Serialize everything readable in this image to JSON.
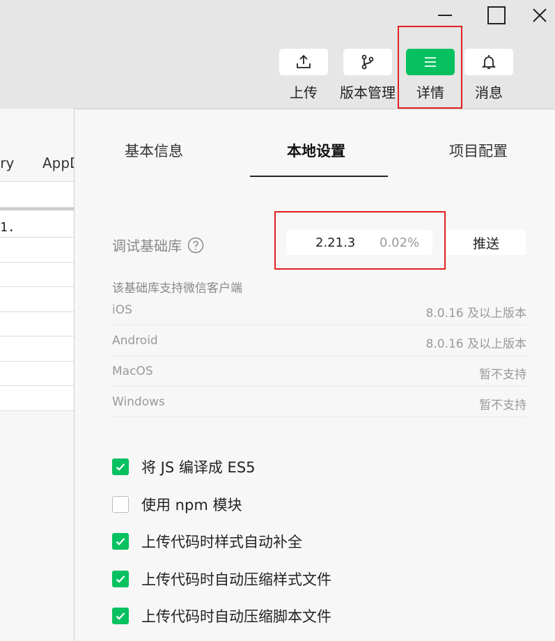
{
  "toolbar": {
    "upload_label": "上传",
    "version_label": "版本管理",
    "detail_label": "详情",
    "message_label": "消息"
  },
  "left_pane": {
    "tab1": "ory",
    "tab2": "AppD",
    "code_fragment": "1."
  },
  "panel": {
    "tabs": [
      {
        "label": "基本信息"
      },
      {
        "label": "本地设置"
      },
      {
        "label": "项目配置"
      }
    ],
    "active_tab": "本地设置",
    "lib_label": "调试基础库",
    "lib_version": "2.21.3",
    "lib_percent": "0.02%",
    "push_label": "推送",
    "support_title": "该基础库支持微信客户端",
    "support": [
      {
        "name": "iOS",
        "value": "8.0.16 及以上版本"
      },
      {
        "name": "Android",
        "value": "8.0.16 及以上版本"
      },
      {
        "name": "MacOS",
        "value": "暂不支持"
      },
      {
        "name": "Windows",
        "value": "暂不支持"
      }
    ],
    "options": [
      {
        "label": "将 JS 编译成 ES5",
        "checked": true
      },
      {
        "label": "使用 npm 模块",
        "checked": false
      },
      {
        "label": "上传代码时样式自动补全",
        "checked": true
      },
      {
        "label": "上传代码时自动压缩样式文件",
        "checked": true
      },
      {
        "label": "上传代码时自动压缩脚本文件",
        "checked": true
      }
    ]
  },
  "colors": {
    "accent": "#07c160",
    "highlight": "#e02020"
  }
}
